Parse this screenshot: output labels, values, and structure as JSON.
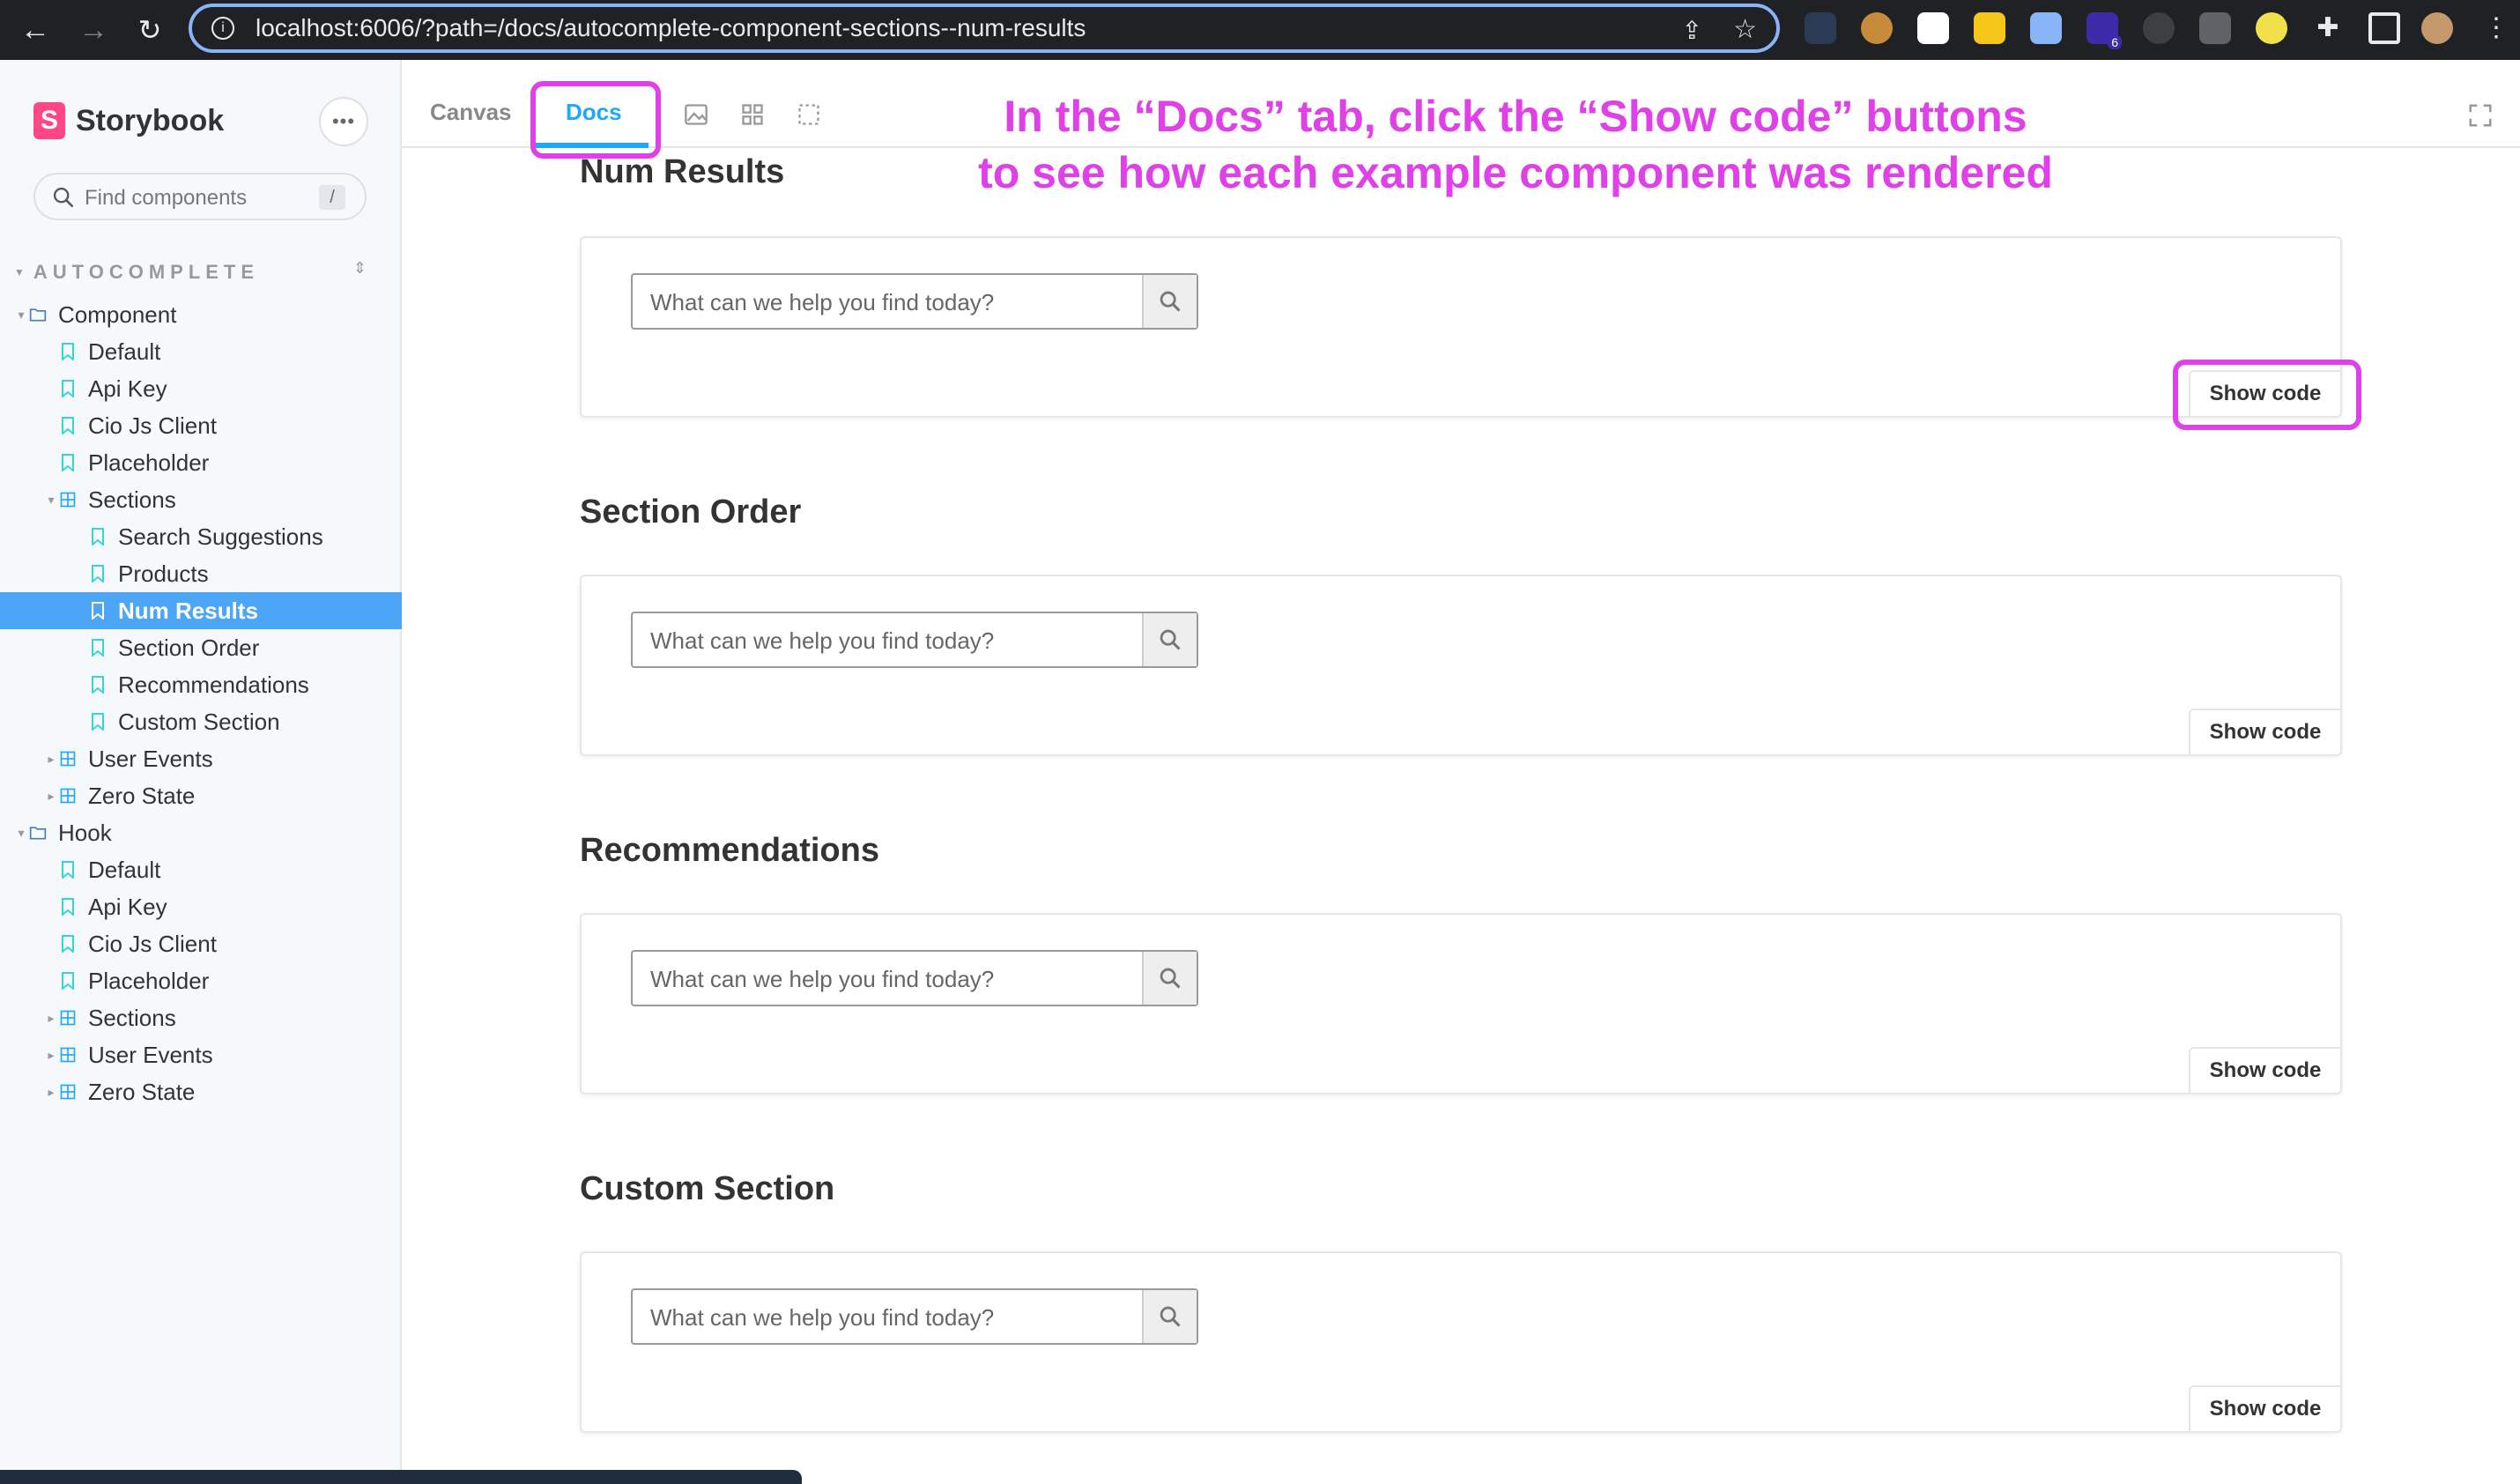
{
  "browser": {
    "url": "localhost:6006/?path=/docs/autocomplete-component-sections--num-results",
    "extension_badge": "6"
  },
  "sidebar": {
    "brand": "Storybook",
    "logo_letter": "S",
    "menu_label": "•••",
    "search_placeholder": "Find components",
    "search_shortcut": "/",
    "section_header": "AUTOCOMPLETE",
    "tree": [
      {
        "label": "Component",
        "type": "folder",
        "depth": 0,
        "expanded": true
      },
      {
        "label": "Default",
        "type": "story",
        "depth": 1
      },
      {
        "label": "Api Key",
        "type": "story",
        "depth": 1
      },
      {
        "label": "Cio Js Client",
        "type": "story",
        "depth": 1
      },
      {
        "label": "Placeholder",
        "type": "story",
        "depth": 1
      },
      {
        "label": "Sections",
        "type": "component",
        "depth": 1,
        "expanded": true
      },
      {
        "label": "Search Suggestions",
        "type": "story",
        "depth": 2
      },
      {
        "label": "Products",
        "type": "story",
        "depth": 2
      },
      {
        "label": "Num Results",
        "type": "story",
        "depth": 2,
        "active": true
      },
      {
        "label": "Section Order",
        "type": "story",
        "depth": 2
      },
      {
        "label": "Recommendations",
        "type": "story",
        "depth": 2
      },
      {
        "label": "Custom Section",
        "type": "story",
        "depth": 2
      },
      {
        "label": "User Events",
        "type": "component",
        "depth": 1,
        "expanded": false
      },
      {
        "label": "Zero State",
        "type": "component",
        "depth": 1,
        "expanded": false
      },
      {
        "label": "Hook",
        "type": "folder",
        "depth": 0,
        "expanded": true
      },
      {
        "label": "Default",
        "type": "story",
        "depth": 1
      },
      {
        "label": "Api Key",
        "type": "story",
        "depth": 1
      },
      {
        "label": "Cio Js Client",
        "type": "story",
        "depth": 1
      },
      {
        "label": "Placeholder",
        "type": "story",
        "depth": 1
      },
      {
        "label": "Sections",
        "type": "component",
        "depth": 1,
        "expanded": false
      },
      {
        "label": "User Events",
        "type": "component",
        "depth": 1,
        "expanded": false
      },
      {
        "label": "Zero State",
        "type": "component",
        "depth": 1,
        "expanded": false
      }
    ]
  },
  "toolbar": {
    "tabs": [
      {
        "label": "Canvas",
        "active": false
      },
      {
        "label": "Docs",
        "active": true
      }
    ]
  },
  "annotation": {
    "line1": "In the “Docs” tab, click the “Show code” buttons",
    "line2": "to see how each example component was rendered"
  },
  "docs": {
    "sections": [
      {
        "title": "Num Results",
        "input_placeholder": "What can we help you find today?",
        "show_code_label": "Show code"
      },
      {
        "title": "Section Order",
        "input_placeholder": "What can we help you find today?",
        "show_code_label": "Show code"
      },
      {
        "title": "Recommendations",
        "input_placeholder": "What can we help you find today?",
        "show_code_label": "Show code"
      },
      {
        "title": "Custom Section",
        "input_placeholder": "What can we help you find today?",
        "show_code_label": "Show code"
      }
    ]
  },
  "colors": {
    "accent": "#1ea7fd",
    "active_row": "#4da6f5",
    "annotation": "#e040e8",
    "storybook_pink": "#ff4785"
  }
}
